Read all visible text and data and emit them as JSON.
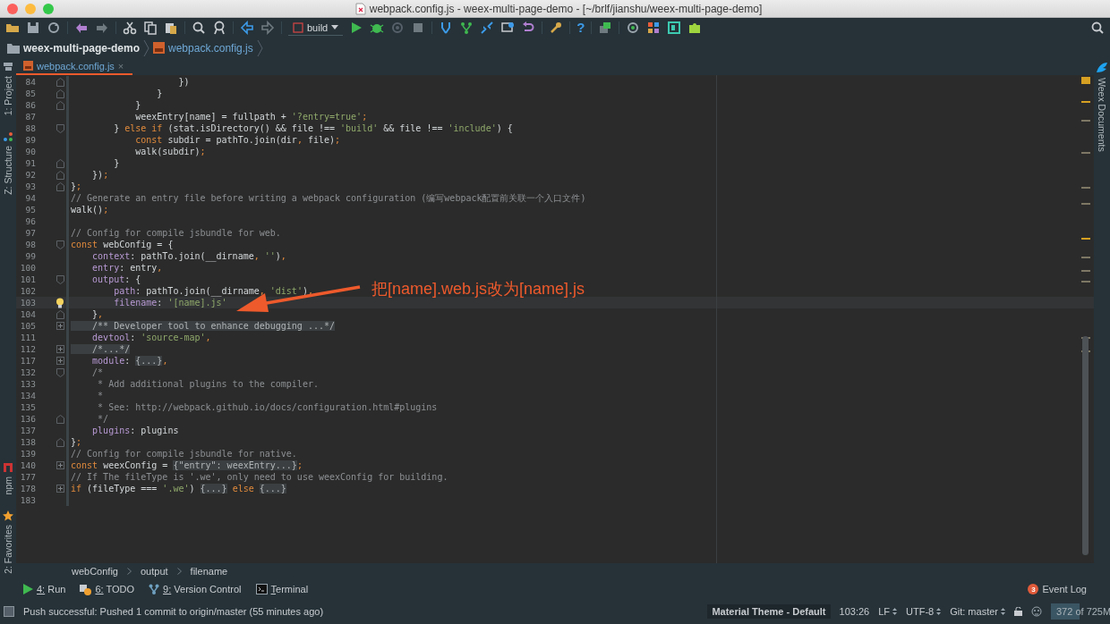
{
  "window": {
    "title": "webpack.config.js - weex-multi-page-demo - [~/brlf/jianshu/weex-multi-page-demo]"
  },
  "toolbar": {
    "run_config": "build",
    "help": "?"
  },
  "navigation": [
    {
      "kind": "folder",
      "label": "weex-multi-page-demo"
    },
    {
      "kind": "file",
      "label": "webpack.config.js"
    }
  ],
  "tabs": [
    {
      "label": "webpack.config.js",
      "close": "×",
      "selected": true
    }
  ],
  "left_tool_windows": {
    "top": [
      {
        "kind": "project",
        "label": "1: Project"
      },
      {
        "kind": "structure",
        "label": "Z: Structure"
      }
    ],
    "bottom": [
      {
        "kind": "npm",
        "label": "npm"
      },
      {
        "kind": "favorites",
        "label": "2: Favorites"
      }
    ]
  },
  "right_tool_windows": [
    {
      "label": "Weex Documents"
    }
  ],
  "editor": {
    "annotation": "把[name].web.js改为[name].js",
    "lines": [
      {
        "num": "84",
        "current": false,
        "kind": "fold_end",
        "tokens": [
          {
            "kind": "plain",
            "text": "                    })"
          }
        ]
      },
      {
        "num": "85",
        "current": false,
        "kind": "fold_end",
        "tokens": [
          {
            "kind": "plain",
            "text": "                }"
          }
        ]
      },
      {
        "num": "86",
        "current": false,
        "kind": "fold_end",
        "tokens": [
          {
            "kind": "plain",
            "text": "            }"
          }
        ]
      },
      {
        "num": "87",
        "current": false,
        "kind": "plain",
        "tokens": [
          {
            "kind": "plain",
            "text": "            weexEntry[name] = fullpath + "
          },
          {
            "kind": "string",
            "text": "'?entry=true'"
          },
          {
            "kind": "keyword",
            "text": ";"
          }
        ]
      },
      {
        "num": "88",
        "current": false,
        "kind": "fold_start",
        "tokens": [
          {
            "kind": "plain",
            "text": "        } "
          },
          {
            "kind": "keyword",
            "text": "else if"
          },
          {
            "kind": "plain",
            "text": " (stat.isDirectory() && file !== "
          },
          {
            "kind": "string",
            "text": "'build'"
          },
          {
            "kind": "plain",
            "text": " && file !== "
          },
          {
            "kind": "string",
            "text": "'include'"
          },
          {
            "kind": "plain",
            "text": ") {"
          }
        ]
      },
      {
        "num": "89",
        "current": false,
        "kind": "plain",
        "tokens": [
          {
            "kind": "keyword",
            "text": "            const"
          },
          {
            "kind": "plain",
            "text": " subdir = pathTo.join(dir"
          },
          {
            "kind": "keyword",
            "text": ","
          },
          {
            "kind": "plain",
            "text": " file)"
          },
          {
            "kind": "keyword",
            "text": ";"
          }
        ]
      },
      {
        "num": "90",
        "current": false,
        "kind": "plain",
        "tokens": [
          {
            "kind": "plain",
            "text": "            walk(subdir)"
          },
          {
            "kind": "keyword",
            "text": ";"
          }
        ]
      },
      {
        "num": "91",
        "current": false,
        "kind": "fold_end",
        "tokens": [
          {
            "kind": "plain",
            "text": "        }"
          }
        ]
      },
      {
        "num": "92",
        "current": false,
        "kind": "fold_end",
        "tokens": [
          {
            "kind": "plain",
            "text": "    })"
          },
          {
            "kind": "keyword",
            "text": ";"
          }
        ]
      },
      {
        "num": "93",
        "current": false,
        "kind": "fold_end",
        "tokens": [
          {
            "kind": "plain",
            "text": "}"
          },
          {
            "kind": "keyword",
            "text": ";"
          }
        ]
      },
      {
        "num": "94",
        "current": false,
        "kind": "plain",
        "tokens": [
          {
            "kind": "comment",
            "text": "// Generate an entry file before writing a webpack configuration (编写webpack配置前关联一个入口文件)"
          }
        ]
      },
      {
        "num": "95",
        "current": false,
        "kind": "plain",
        "tokens": [
          {
            "kind": "plain",
            "text": "walk()"
          },
          {
            "kind": "keyword",
            "text": ";"
          }
        ]
      },
      {
        "num": "96",
        "current": false,
        "kind": "plain"
      },
      {
        "num": "97",
        "current": false,
        "kind": "plain",
        "tokens": [
          {
            "kind": "comment",
            "text": "// Config for compile jsbundle for web."
          }
        ]
      },
      {
        "num": "98",
        "current": false,
        "kind": "fold_start",
        "tokens": [
          {
            "kind": "keyword",
            "text": "const"
          },
          {
            "kind": "plain",
            "text": " webConfig = {"
          }
        ]
      },
      {
        "num": "99",
        "current": false,
        "kind": "plain",
        "tokens": [
          {
            "kind": "field",
            "text": "    context"
          },
          {
            "kind": "plain",
            "text": ": pathTo.join(__dirname"
          },
          {
            "kind": "keyword",
            "text": ", "
          },
          {
            "kind": "string",
            "text": "''"
          },
          {
            "kind": "plain",
            "text": ")"
          },
          {
            "kind": "keyword",
            "text": ","
          }
        ]
      },
      {
        "num": "100",
        "current": false,
        "kind": "plain",
        "tokens": [
          {
            "kind": "field",
            "text": "    entry"
          },
          {
            "kind": "plain",
            "text": ": entry"
          },
          {
            "kind": "keyword",
            "text": ","
          }
        ]
      },
      {
        "num": "101",
        "current": false,
        "kind": "fold_start",
        "tokens": [
          {
            "kind": "field",
            "text": "    output"
          },
          {
            "kind": "plain",
            "text": ": {"
          }
        ]
      },
      {
        "num": "102",
        "current": false,
        "kind": "plain",
        "tokens": [
          {
            "kind": "field",
            "text": "        path"
          },
          {
            "kind": "plain",
            "text": ": pathTo.join(__dirname"
          },
          {
            "kind": "keyword",
            "text": ", "
          },
          {
            "kind": "string",
            "text": "'dist'"
          },
          {
            "kind": "plain",
            "text": ")"
          },
          {
            "kind": "keyword",
            "text": ","
          }
        ]
      },
      {
        "num": "103",
        "current": true,
        "kind": "plain",
        "tokens": [
          {
            "kind": "field",
            "text": "        filename"
          },
          {
            "kind": "plain",
            "text": ": "
          },
          {
            "kind": "string",
            "text": "'[name].js'"
          }
        ]
      },
      {
        "num": "104",
        "current": false,
        "kind": "fold_end",
        "tokens": [
          {
            "kind": "plain",
            "text": "    }"
          },
          {
            "kind": "keyword",
            "text": ","
          }
        ]
      },
      {
        "num": "105",
        "current": false,
        "kind": "collapsed",
        "tokens": [
          {
            "kind": "folded",
            "text": "    /** Developer tool to enhance debugging ...*/"
          }
        ]
      },
      {
        "num": "111",
        "current": false,
        "kind": "plain",
        "tokens": [
          {
            "kind": "field",
            "text": "    devtool"
          },
          {
            "kind": "plain",
            "text": ": "
          },
          {
            "kind": "string",
            "text": "'source-map'"
          },
          {
            "kind": "keyword",
            "text": ","
          }
        ]
      },
      {
        "num": "112",
        "current": false,
        "kind": "collapsed",
        "tokens": [
          {
            "kind": "folded",
            "text": "    /*...*/"
          }
        ]
      },
      {
        "num": "117",
        "current": false,
        "kind": "collapsed",
        "tokens": [
          {
            "kind": "field",
            "text": "    module"
          },
          {
            "kind": "plain",
            "text": ": "
          },
          {
            "kind": "folded",
            "text": "{...}"
          },
          {
            "kind": "keyword",
            "text": ","
          }
        ]
      },
      {
        "num": "132",
        "current": false,
        "kind": "fold_start",
        "tokens": [
          {
            "kind": "comment",
            "text": "    /*"
          }
        ]
      },
      {
        "num": "133",
        "current": false,
        "kind": "plain",
        "tokens": [
          {
            "kind": "comment",
            "text": "     * Add additional plugins to the compiler."
          }
        ]
      },
      {
        "num": "134",
        "current": false,
        "kind": "plain",
        "tokens": [
          {
            "kind": "comment",
            "text": "     *"
          }
        ]
      },
      {
        "num": "135",
        "current": false,
        "kind": "plain",
        "tokens": [
          {
            "kind": "comment",
            "text": "     * See: http://webpack.github.io/docs/configuration.html#plugins"
          }
        ]
      },
      {
        "num": "136",
        "current": false,
        "kind": "fold_end",
        "tokens": [
          {
            "kind": "comment",
            "text": "     */"
          }
        ]
      },
      {
        "num": "137",
        "current": false,
        "kind": "plain",
        "tokens": [
          {
            "kind": "field",
            "text": "    plugins"
          },
          {
            "kind": "plain",
            "text": ": plugins"
          }
        ]
      },
      {
        "num": "138",
        "current": false,
        "kind": "fold_end",
        "tokens": [
          {
            "kind": "plain",
            "text": "}"
          },
          {
            "kind": "keyword",
            "text": ";"
          }
        ]
      },
      {
        "num": "139",
        "current": false,
        "kind": "plain",
        "tokens": [
          {
            "kind": "comment",
            "text": "// Config for compile jsbundle for native."
          }
        ]
      },
      {
        "num": "140",
        "current": false,
        "kind": "collapsed",
        "tokens": [
          {
            "kind": "keyword",
            "text": "const"
          },
          {
            "kind": "plain",
            "text": " weexConfig = "
          },
          {
            "kind": "folded",
            "text": "{\"entry\": weexEntry...}"
          },
          {
            "kind": "keyword",
            "text": ";"
          }
        ]
      },
      {
        "num": "177",
        "current": false,
        "kind": "plain",
        "tokens": [
          {
            "kind": "comment",
            "text": "// If The fileType is '.we', only need to use weexConfig for building."
          }
        ]
      },
      {
        "num": "178",
        "current": false,
        "kind": "collapsed",
        "tokens": [
          {
            "kind": "keyword",
            "text": "if"
          },
          {
            "kind": "plain",
            "text": " (fileType === "
          },
          {
            "kind": "string",
            "text": "'.we'"
          },
          {
            "kind": "plain",
            "text": ") "
          },
          {
            "kind": "folded",
            "text": "{...}"
          },
          {
            "kind": "keyword",
            "text": " else "
          },
          {
            "kind": "folded",
            "text": "{...}"
          }
        ]
      },
      {
        "num": "183",
        "current": false,
        "kind": "plain"
      }
    ]
  },
  "breadcrumbs": [
    "webConfig",
    "output",
    "filename"
  ],
  "tool_windows": [
    {
      "kind": "run",
      "label": "4: Run"
    },
    {
      "kind": "todo",
      "label": "6: TODO"
    },
    {
      "kind": "vcs",
      "label": "9: Version Control"
    },
    {
      "kind": "terminal",
      "label": "Terminal"
    }
  ],
  "event_log": {
    "count": "3",
    "label": "Event Log"
  },
  "status_bar": {
    "message": "Push successful: Pushed 1 commit to origin/master (55 minutes ago)",
    "theme": "Material Theme - Default",
    "position": "103:26",
    "line_separator": "LF",
    "encoding": "UTF-8",
    "vcs": "Git: master",
    "memory": {
      "text": "372 of 725M",
      "level": 0.51
    }
  }
}
